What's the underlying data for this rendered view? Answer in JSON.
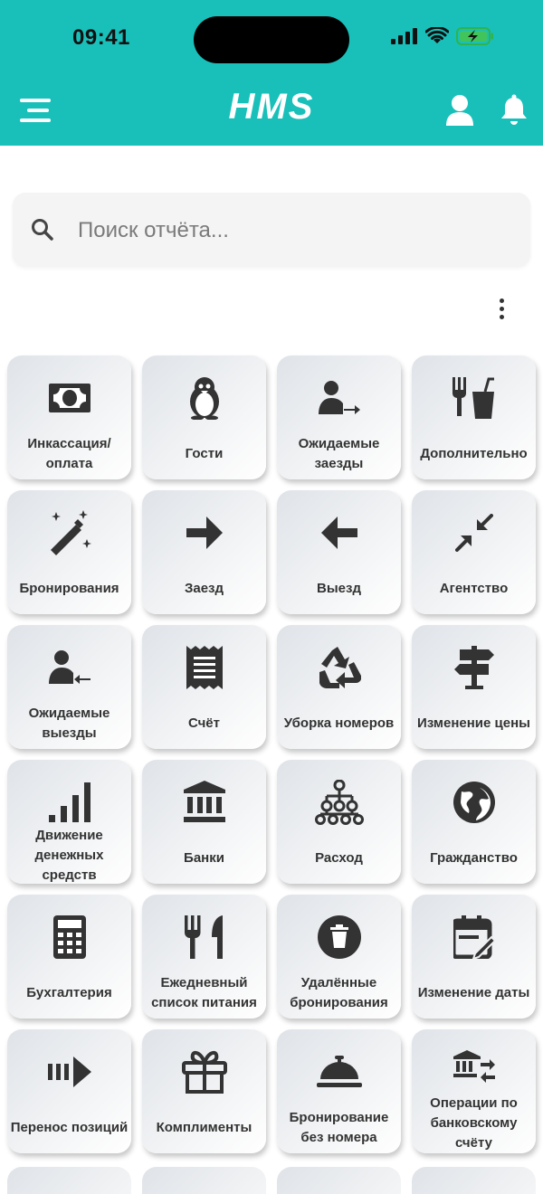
{
  "status": {
    "time": "09:41"
  },
  "header": {
    "logo": "HMS"
  },
  "search": {
    "placeholder": "Поиск отчёта..."
  },
  "tiles": [
    {
      "label": "Инкассация/\nоплата",
      "icon": "money-icon"
    },
    {
      "label": "Гости",
      "icon": "penguin-icon"
    },
    {
      "label": "Ожидаемые заезды",
      "icon": "user-arrow-in-icon"
    },
    {
      "label": "Дополнительно",
      "icon": "food-drink-icon"
    },
    {
      "label": "Бронирования",
      "icon": "magic-wand-icon"
    },
    {
      "label": "Заезд",
      "icon": "arrow-right-icon"
    },
    {
      "label": "Выезд",
      "icon": "arrow-left-icon"
    },
    {
      "label": "Агентство",
      "icon": "compress-icon"
    },
    {
      "label": "Ожидаемые выезды",
      "icon": "user-arrow-out-icon"
    },
    {
      "label": "Счёт",
      "icon": "receipt-icon"
    },
    {
      "label": "Уборка номеров",
      "icon": "recycle-icon"
    },
    {
      "label": "Изменение цены",
      "icon": "signpost-icon"
    },
    {
      "label": "Движение денежных средств",
      "icon": "signal-bars-icon"
    },
    {
      "label": "Банки",
      "icon": "bank-icon"
    },
    {
      "label": "Расход",
      "icon": "sitemap-icon"
    },
    {
      "label": "Гражданство",
      "icon": "globe-icon"
    },
    {
      "label": "Бухгалтерия",
      "icon": "calculator-icon"
    },
    {
      "label": "Ежедневный список питания",
      "icon": "utensils-icon"
    },
    {
      "label": "Удалённые бронирования",
      "icon": "trash-icon"
    },
    {
      "label": "Изменение даты",
      "icon": "calendar-edit-icon"
    },
    {
      "label": "Перенос позиций",
      "icon": "transfer-icon"
    },
    {
      "label": "Комплименты",
      "icon": "gift-icon"
    },
    {
      "label": "Бронирование без номера",
      "icon": "cloche-icon"
    },
    {
      "label": "Операции по банковскому счёту",
      "icon": "bank-transfer-icon"
    }
  ]
}
